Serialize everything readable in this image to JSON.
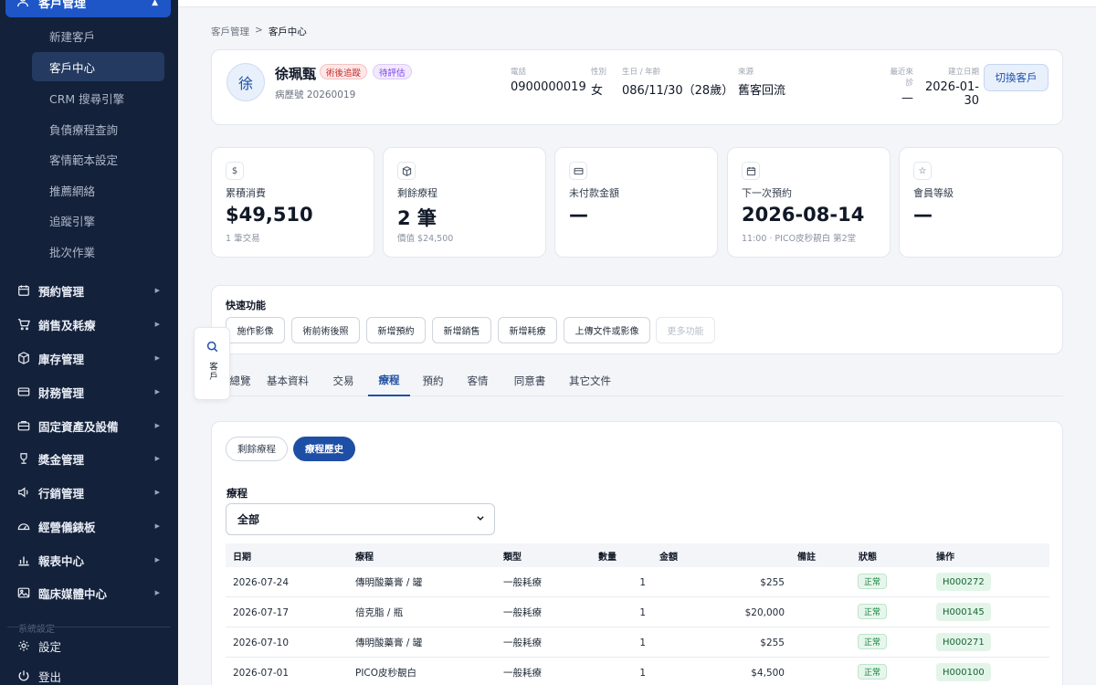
{
  "sidebar": {
    "parent_label": "客戶管理",
    "sub_items": [
      "新建客戶",
      "客戶中心",
      "CRM 搜尋引擎",
      "負債療程查詢",
      "客情範本設定",
      "推薦網絡",
      "追蹤引擎",
      "批次作業"
    ],
    "active_sub": "客戶中心",
    "menu": [
      {
        "label": "預約管理",
        "icon": "calendar-icon"
      },
      {
        "label": "銷售及耗療",
        "icon": "cart-icon"
      },
      {
        "label": "庫存管理",
        "icon": "box-icon"
      },
      {
        "label": "財務管理",
        "icon": "card-icon"
      },
      {
        "label": "固定資產及設備",
        "icon": "briefcase-icon"
      },
      {
        "label": "獎金管理",
        "icon": "trophy-icon"
      },
      {
        "label": "行銷管理",
        "icon": "megaphone-icon"
      },
      {
        "label": "經營儀錶板",
        "icon": "gauge-icon"
      },
      {
        "label": "報表中心",
        "icon": "bar-chart-icon"
      },
      {
        "label": "臨床媒體中心",
        "icon": "image-icon"
      }
    ],
    "faded_label": "系統設定",
    "settings_label": "設定",
    "logout_label": "登出"
  },
  "breadcrumb": {
    "root": "客戶管理",
    "sep": ">",
    "current": "客戶中心"
  },
  "patient": {
    "avatar": "徐",
    "name": "徐珮甄",
    "badge_1": "術後追蹤",
    "badge_2": "待評估",
    "record": "病歷號 20260019",
    "phone_label": "電話",
    "phone": "0900000019",
    "gender_label": "性別",
    "gender": "女",
    "birth_label": "生日 / 年齡",
    "birth": "086/11/30（28歲）",
    "source_label": "來源",
    "source": "舊客回流",
    "last_visit_label": "最近來診",
    "last_visit": "—",
    "created_label": "建立日期",
    "created": "2026-01-30",
    "switch_label": "切換客戶"
  },
  "stats": [
    {
      "icon": "dollar-icon",
      "label": "累積消費",
      "value": "$49,510",
      "sub": "1 筆交易"
    },
    {
      "icon": "package-icon",
      "label": "剩餘療程",
      "value": "2 筆",
      "sub": "價值 $24,500"
    },
    {
      "icon": "credit-card-icon",
      "label": "未付款金額",
      "value": "—",
      "sub": ""
    },
    {
      "icon": "calendar-icon",
      "label": "下一次預約",
      "value": "2026-08-14",
      "sub": "11:00 · PICO皮秒靚白 第2堂"
    },
    {
      "icon": "star-icon",
      "label": "會員等級",
      "value": "—",
      "sub": ""
    }
  ],
  "quick": {
    "title": "快速功能",
    "buttons": [
      "施作影像",
      "術前術後照",
      "新增預約",
      "新增銷售",
      "新增耗療",
      "上傳文件或影像",
      "更多功能"
    ]
  },
  "float_search": {
    "label": "客戶"
  },
  "tabs": [
    "總覽",
    "基本資料",
    "交易",
    "療程",
    "預約",
    "客情",
    "同意書",
    "其它文件"
  ],
  "active_tab": "療程",
  "history": {
    "pill_off": "剩餘療程",
    "pill_on": "療程歷史",
    "filter_label": "療程",
    "filter_value": "全部",
    "columns": [
      "日期",
      "療程",
      "類型",
      "數量",
      "金額",
      "備註",
      "狀態",
      "操作"
    ],
    "rows": [
      {
        "date": "2026-07-24",
        "name": "傳明酸藥膏 / 罐",
        "type": "一般耗療",
        "qty": "1",
        "amount": "$255",
        "note": "",
        "status": "正常",
        "op": "H000272"
      },
      {
        "date": "2026-07-17",
        "name": "倍克脂 / 瓶",
        "type": "一般耗療",
        "qty": "1",
        "amount": "$20,000",
        "note": "",
        "status": "正常",
        "op": "H000145"
      },
      {
        "date": "2026-07-10",
        "name": "傳明酸藥膏 / 罐",
        "type": "一般耗療",
        "qty": "1",
        "amount": "$255",
        "note": "",
        "status": "正常",
        "op": "H000271"
      },
      {
        "date": "2026-07-01",
        "name": "PICO皮秒靚白",
        "type": "一般耗療",
        "qty": "1",
        "amount": "$4,500",
        "note": "",
        "status": "正常",
        "op": "H000100"
      }
    ]
  }
}
